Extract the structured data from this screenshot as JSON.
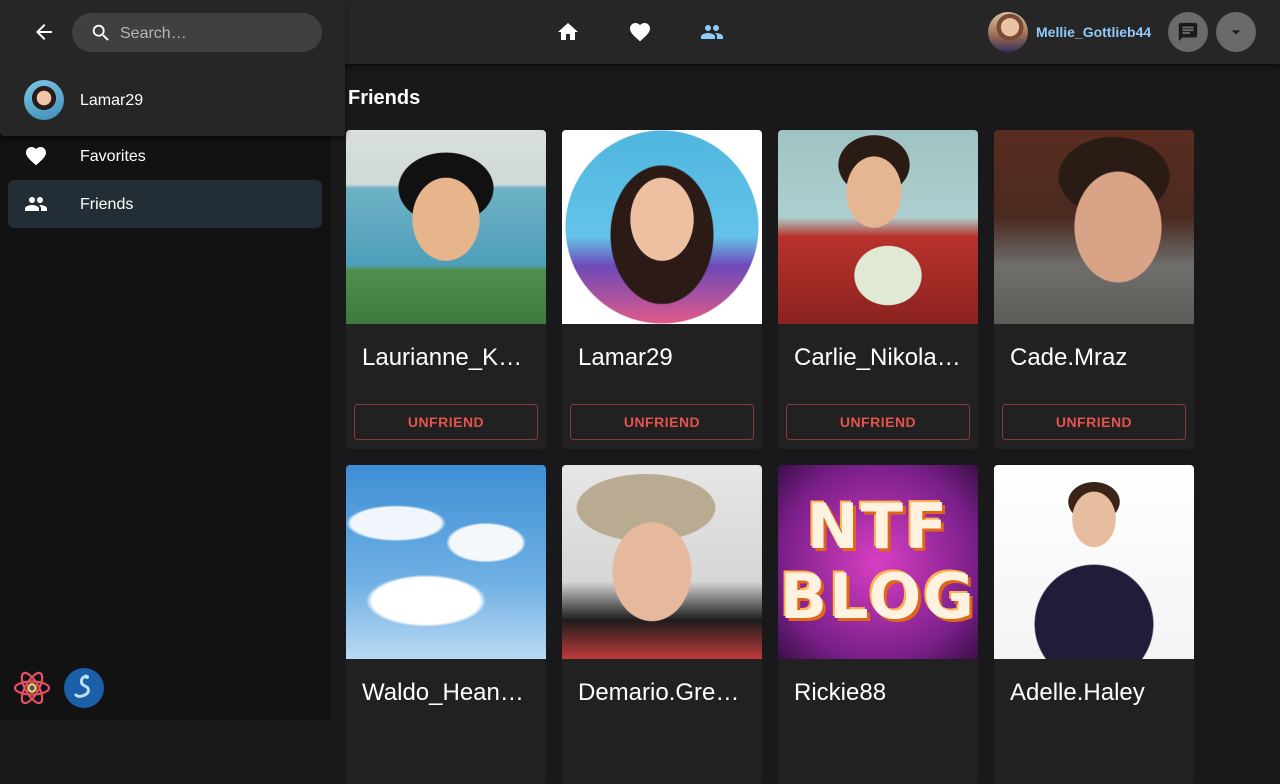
{
  "colors": {
    "background": "#19191b",
    "appbar": "#262626",
    "drawer": "#121212",
    "active_nav": "#90caf9",
    "danger": "#e5534d"
  },
  "search": {
    "placeholder": "Search…",
    "back_icon": "arrow-back-icon",
    "results": [
      {
        "label": "Lamar29"
      }
    ]
  },
  "sidebar": {
    "items": [
      {
        "label": "Favorites",
        "icon": "heart-icon",
        "active": false
      },
      {
        "label": "Friends",
        "icon": "people-icon",
        "active": true
      }
    ]
  },
  "header": {
    "nav": [
      {
        "icon": "home-icon",
        "active": false
      },
      {
        "icon": "heart-icon",
        "active": false
      },
      {
        "icon": "people-icon",
        "active": true
      }
    ],
    "username": "Mellie_Gottlieb44",
    "chat_icon": "chat-icon",
    "menu_icon": "dropdown-arrow-icon"
  },
  "main": {
    "title": "Friends",
    "friends": [
      {
        "name": "Laurianne_Ku…",
        "action": "UNFRIEND"
      },
      {
        "name": "Lamar29",
        "action": "UNFRIEND"
      },
      {
        "name": "Carlie_Nikolaus",
        "action": "UNFRIEND"
      },
      {
        "name": "Cade.Mraz",
        "action": "UNFRIEND"
      },
      {
        "name": "Waldo_Heane…"
      },
      {
        "name": "Demario.Gree…"
      },
      {
        "name": "Rickie88",
        "photo_text": [
          "NTF",
          "BLOG"
        ]
      },
      {
        "name": "Adelle.Haley"
      }
    ]
  },
  "footer": {
    "logos": [
      "react-logo-icon",
      "redux-saga-logo-icon"
    ]
  }
}
